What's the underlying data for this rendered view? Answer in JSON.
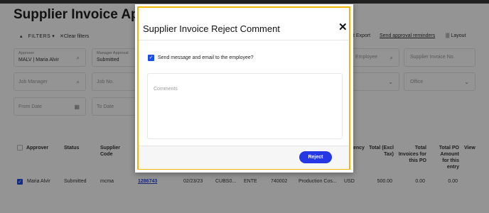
{
  "page": {
    "title": "Supplier Invoice Approv"
  },
  "toolbar": {
    "filters_label": "FILTERS",
    "clear_filters_label": "Clear filters",
    "export_label": "t Export",
    "send_reminders_label": "Send approval reminders",
    "layout_label": "Layout"
  },
  "filters": {
    "approver": {
      "label": "Approver",
      "value": "MALV | Maria Alvir"
    },
    "manager_approval": {
      "label": "Manager Approval",
      "value": "Submitted"
    },
    "employee": {
      "placeholder": "Employee"
    },
    "supplier_invoice_no": {
      "placeholder": "Supplier Invoice No."
    },
    "job_manager": {
      "placeholder": "Job Manager"
    },
    "job_no": {
      "placeholder": "Job No."
    },
    "office": {
      "placeholder": "Office"
    },
    "from_date": {
      "placeholder": "From Date"
    },
    "to_date": {
      "placeholder": "To Date"
    }
  },
  "table": {
    "headers": {
      "approver": "Approver",
      "status": "Status",
      "supplier_code": "Supplier Code",
      "currency": "ency",
      "total_excl_tax": "Total (Excl Tax)",
      "total_invoices_po": "Total Invoices for this PO",
      "total_po_amount": "Total PO Amount for this entry",
      "view": "View"
    },
    "rows": [
      {
        "approver": "Maria Alvir",
        "status": "Submitted",
        "supplier_code": "mcma",
        "invoice_link": "1286743",
        "date": "02/23/23",
        "col_a": "CUBS0...",
        "col_b": "ENTE",
        "col_c": "740002",
        "col_d": "Production Cos...",
        "currency": "USD",
        "total_excl_tax": "500.00",
        "total_invoices_po": "0.00",
        "total_po_amount": "0.00"
      }
    ]
  },
  "modal": {
    "title": "Supplier Invoice Reject Comment",
    "close_symbol": "✕",
    "notify_label": "Send message and email to the employee?",
    "notify_checked": true,
    "comments_placeholder": "Comments",
    "reject_label": "Reject"
  },
  "colors": {
    "accent_blue": "#2637e6",
    "modal_border": "#f2b705",
    "overlay": "rgba(0,0,0,0.42)"
  }
}
